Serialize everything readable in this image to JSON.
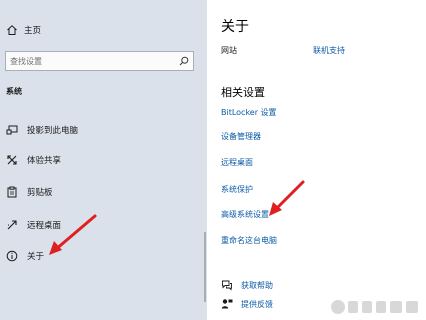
{
  "sidebar": {
    "home_label": "主页",
    "search_placeholder": "查找设置",
    "section_label": "系统",
    "items": [
      {
        "label": "投影到此电脑",
        "icon": "projector-icon"
      },
      {
        "label": "体验共享",
        "icon": "shared-experiences-icon"
      },
      {
        "label": "剪贴板",
        "icon": "clipboard-icon"
      },
      {
        "label": "远程桌面",
        "icon": "remote-desktop-icon"
      },
      {
        "label": "关于",
        "icon": "info-icon"
      }
    ]
  },
  "content": {
    "title": "关于",
    "site_label": "网站",
    "contact_link": "联机支持",
    "related_heading": "相关设置",
    "links": [
      "BitLocker 设置",
      "设备管理器",
      "远程桌面",
      "系统保护",
      "高级系统设置",
      "重命名这台电脑"
    ],
    "help": [
      {
        "label": "获取帮助",
        "icon": "get-help-icon"
      },
      {
        "label": "提供反馈",
        "icon": "feedback-icon"
      }
    ]
  },
  "colors": {
    "sidebar_bg": "#dbe1ea",
    "link": "#0a5aa8",
    "annotation_arrow": "#e02020"
  }
}
